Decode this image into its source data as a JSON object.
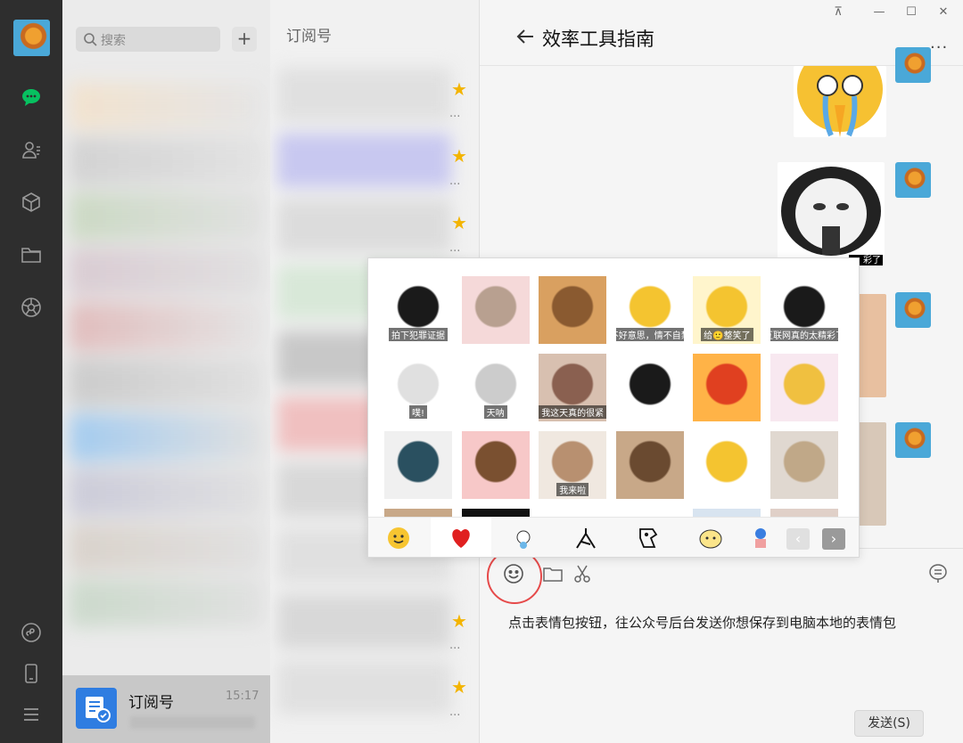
{
  "sidebar": {
    "icons": [
      "avatar",
      "chat-icon",
      "contacts-icon",
      "cube-icon",
      "folder-icon",
      "moments-icon",
      "mini-program-icon",
      "phone-icon",
      "menu-icon"
    ]
  },
  "chatlist": {
    "search_placeholder": "搜索",
    "add_label": "+",
    "subscription_item": {
      "name": "订阅号",
      "time": "15:17"
    }
  },
  "subscriptions": {
    "header": "订阅号"
  },
  "chat": {
    "title": "效率工具指南",
    "more": "...",
    "input_text": "点击表情包按钮，往公众号后台发送你想保存到电脑本地的表情包",
    "send_label": "发送(S)",
    "message_captions": [
      "彩了"
    ]
  },
  "sticker_panel": {
    "stickers": [
      {
        "caption": "拍下犯罪证据",
        "colors": [
          "#ffffff",
          "#1a1a1a"
        ]
      },
      {
        "caption": "",
        "colors": [
          "#f5d9d9",
          "#b8a090"
        ]
      },
      {
        "caption": "",
        "colors": [
          "#d9a060",
          "#8a5a30"
        ]
      },
      {
        "caption": "不好意思，情不自禁",
        "colors": [
          "#ffffff",
          "#f4c430"
        ]
      },
      {
        "caption": "给🙂整笑了",
        "colors": [
          "#fff5cc",
          "#f4c430"
        ]
      },
      {
        "caption": "互联网真的太精彩了",
        "colors": [
          "#ffffff",
          "#1a1a1a"
        ]
      },
      {
        "caption": "噗!",
        "colors": [
          "#ffffff",
          "#e0e0e0"
        ]
      },
      {
        "caption": "天呐",
        "colors": [
          "#ffffff",
          "#cccccc"
        ]
      },
      {
        "caption": "我这天真的很紧",
        "colors": [
          "#d8c0b0",
          "#8a6050"
        ]
      },
      {
        "caption": "",
        "colors": [
          "#ffffff",
          "#1a1a1a"
        ]
      },
      {
        "caption": "",
        "colors": [
          "#ffb347",
          "#e04020"
        ]
      },
      {
        "caption": "",
        "colors": [
          "#f8e8f0",
          "#f0c040"
        ]
      },
      {
        "caption": "",
        "colors": [
          "#f0f0f0",
          "#2a5060"
        ]
      },
      {
        "caption": "",
        "colors": [
          "#f7c8c8",
          "#7a5030"
        ]
      },
      {
        "caption": "我来啦",
        "colors": [
          "#f0e8e0",
          "#b89070"
        ]
      },
      {
        "caption": "",
        "colors": [
          "#c8a888",
          "#6a4a30"
        ]
      },
      {
        "caption": "",
        "colors": [
          "#ffffff",
          "#f4c430"
        ]
      },
      {
        "caption": "",
        "colors": [
          "#e0d8d0",
          "#c0a888"
        ]
      }
    ],
    "tabs": [
      "smile-tab",
      "heart-tab",
      "sticker-tab-1",
      "sticker-tab-2",
      "sticker-tab-3",
      "sticker-tab-4",
      "sticker-tab-5"
    ],
    "nav": {
      "prev": "‹",
      "next": "›"
    }
  },
  "colors": {
    "rail": "#2e2e2e",
    "accent_green": "#07c160",
    "star": "#f3b400",
    "highlight_circle": "#e64a4a",
    "subscription_icon": "#2f7de1"
  }
}
